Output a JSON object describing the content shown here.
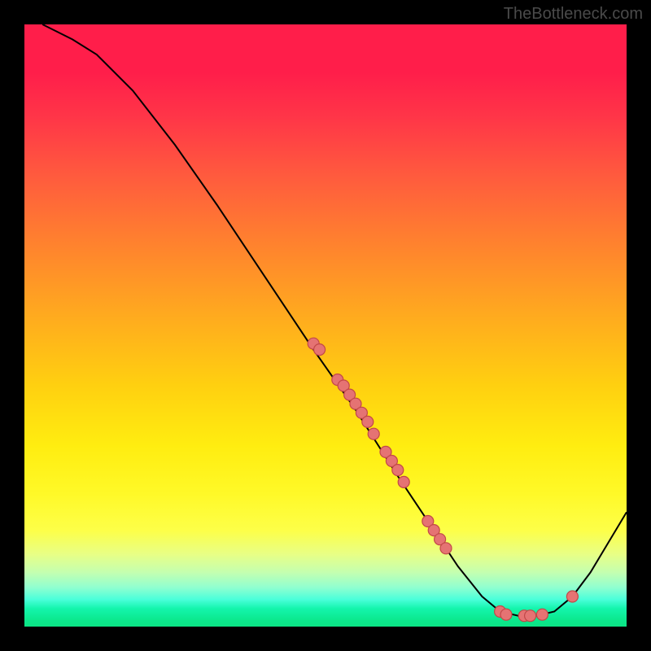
{
  "attribution": "TheBottleneck.com",
  "chart_data": {
    "type": "line",
    "title": "",
    "xlabel": "",
    "ylabel": "",
    "xlim": [
      0,
      100
    ],
    "ylim": [
      0,
      100
    ],
    "curve_points": [
      {
        "x": 3,
        "y": 100
      },
      {
        "x": 5,
        "y": 99
      },
      {
        "x": 8,
        "y": 97.5
      },
      {
        "x": 12,
        "y": 95
      },
      {
        "x": 18,
        "y": 89
      },
      {
        "x": 25,
        "y": 80
      },
      {
        "x": 32,
        "y": 70
      },
      {
        "x": 40,
        "y": 58
      },
      {
        "x": 48,
        "y": 46
      },
      {
        "x": 55,
        "y": 36
      },
      {
        "x": 62,
        "y": 25
      },
      {
        "x": 68,
        "y": 16
      },
      {
        "x": 72,
        "y": 10
      },
      {
        "x": 76,
        "y": 5
      },
      {
        "x": 79,
        "y": 2.5
      },
      {
        "x": 82,
        "y": 1.8
      },
      {
        "x": 85,
        "y": 1.8
      },
      {
        "x": 88,
        "y": 2.5
      },
      {
        "x": 91,
        "y": 5
      },
      {
        "x": 94,
        "y": 9
      },
      {
        "x": 97,
        "y": 14
      },
      {
        "x": 100,
        "y": 19
      }
    ],
    "markers": [
      {
        "x": 48,
        "y": 47
      },
      {
        "x": 49,
        "y": 46
      },
      {
        "x": 52,
        "y": 41
      },
      {
        "x": 53,
        "y": 40
      },
      {
        "x": 54,
        "y": 38.5
      },
      {
        "x": 55,
        "y": 37
      },
      {
        "x": 56,
        "y": 35.5
      },
      {
        "x": 57,
        "y": 34
      },
      {
        "x": 58,
        "y": 32
      },
      {
        "x": 60,
        "y": 29
      },
      {
        "x": 61,
        "y": 27.5
      },
      {
        "x": 62,
        "y": 26
      },
      {
        "x": 63,
        "y": 24
      },
      {
        "x": 67,
        "y": 17.5
      },
      {
        "x": 68,
        "y": 16
      },
      {
        "x": 69,
        "y": 14.5
      },
      {
        "x": 70,
        "y": 13
      },
      {
        "x": 79,
        "y": 2.5
      },
      {
        "x": 80,
        "y": 2
      },
      {
        "x": 83,
        "y": 1.8
      },
      {
        "x": 84,
        "y": 1.8
      },
      {
        "x": 86,
        "y": 2
      },
      {
        "x": 91,
        "y": 5
      }
    ],
    "gradient_colors": {
      "top": "#ff1e4a",
      "middle": "#ffed10",
      "bottom": "#0be485"
    },
    "marker_color": "#e57373"
  }
}
